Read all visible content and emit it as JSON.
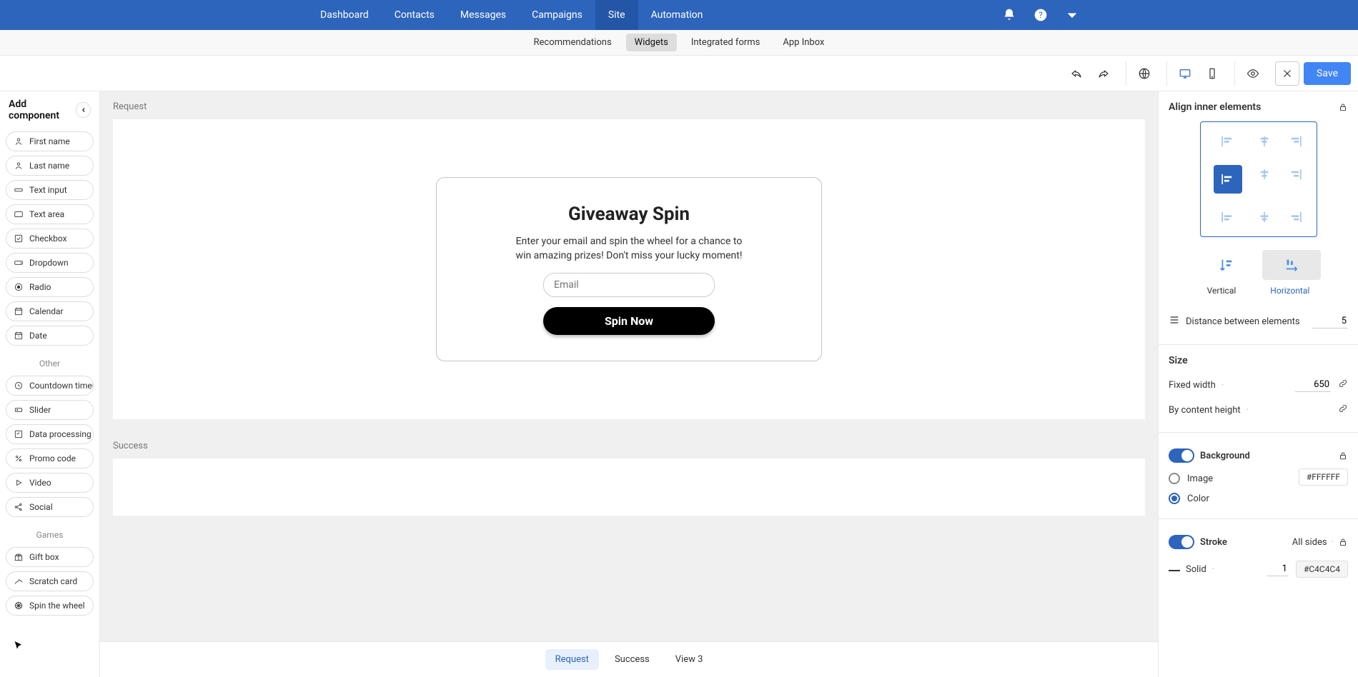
{
  "topnav": {
    "items": [
      "Dashboard",
      "Contacts",
      "Messages",
      "Campaigns",
      "Site",
      "Automation"
    ],
    "active": 4
  },
  "subnav": {
    "items": [
      "Recommendations",
      "Widgets",
      "Integrated forms",
      "App Inbox"
    ],
    "active": 1
  },
  "toolbar": {
    "save": "Save"
  },
  "left": {
    "title": "Add component",
    "inputs": [
      "First name",
      "Last name",
      "Text input",
      "Text area",
      "Checkbox",
      "Dropdown",
      "Radio",
      "Calendar",
      "Date"
    ],
    "other_label": "Other",
    "other": [
      "Countdown timer",
      "Slider",
      "Data processing a",
      "Promo code",
      "Video",
      "Social"
    ],
    "games_label": "Games",
    "games": [
      "Gift box",
      "Scratch card",
      "Spin the wheel"
    ]
  },
  "canvas": {
    "view1": "Request",
    "popup": {
      "title": "Giveaway Spin",
      "desc": "Enter your email and spin the wheel for a chance to win amazing prizes! Don't miss your lucky moment!",
      "placeholder": "Email",
      "button": "Spin Now"
    },
    "view2": "Success"
  },
  "bottom": {
    "tabs": [
      "Request",
      "Success",
      "View 3"
    ],
    "active": 0
  },
  "right": {
    "align_title": "Align inner elements",
    "vertical": "Vertical",
    "horizontal": "Horizontal",
    "distance": "Distance between elements",
    "distance_val": "5",
    "size": "Size",
    "fixed_width": "Fixed width",
    "fixed_width_val": "650",
    "by_content": "By content height",
    "background": "Background",
    "bg_image": "Image",
    "bg_color": "Color",
    "bg_hex": "#FFFFFF",
    "stroke": "Stroke",
    "all_sides": "All sides",
    "solid": "Solid",
    "solid_val": "1",
    "stroke_hex": "#C4C4C4"
  }
}
